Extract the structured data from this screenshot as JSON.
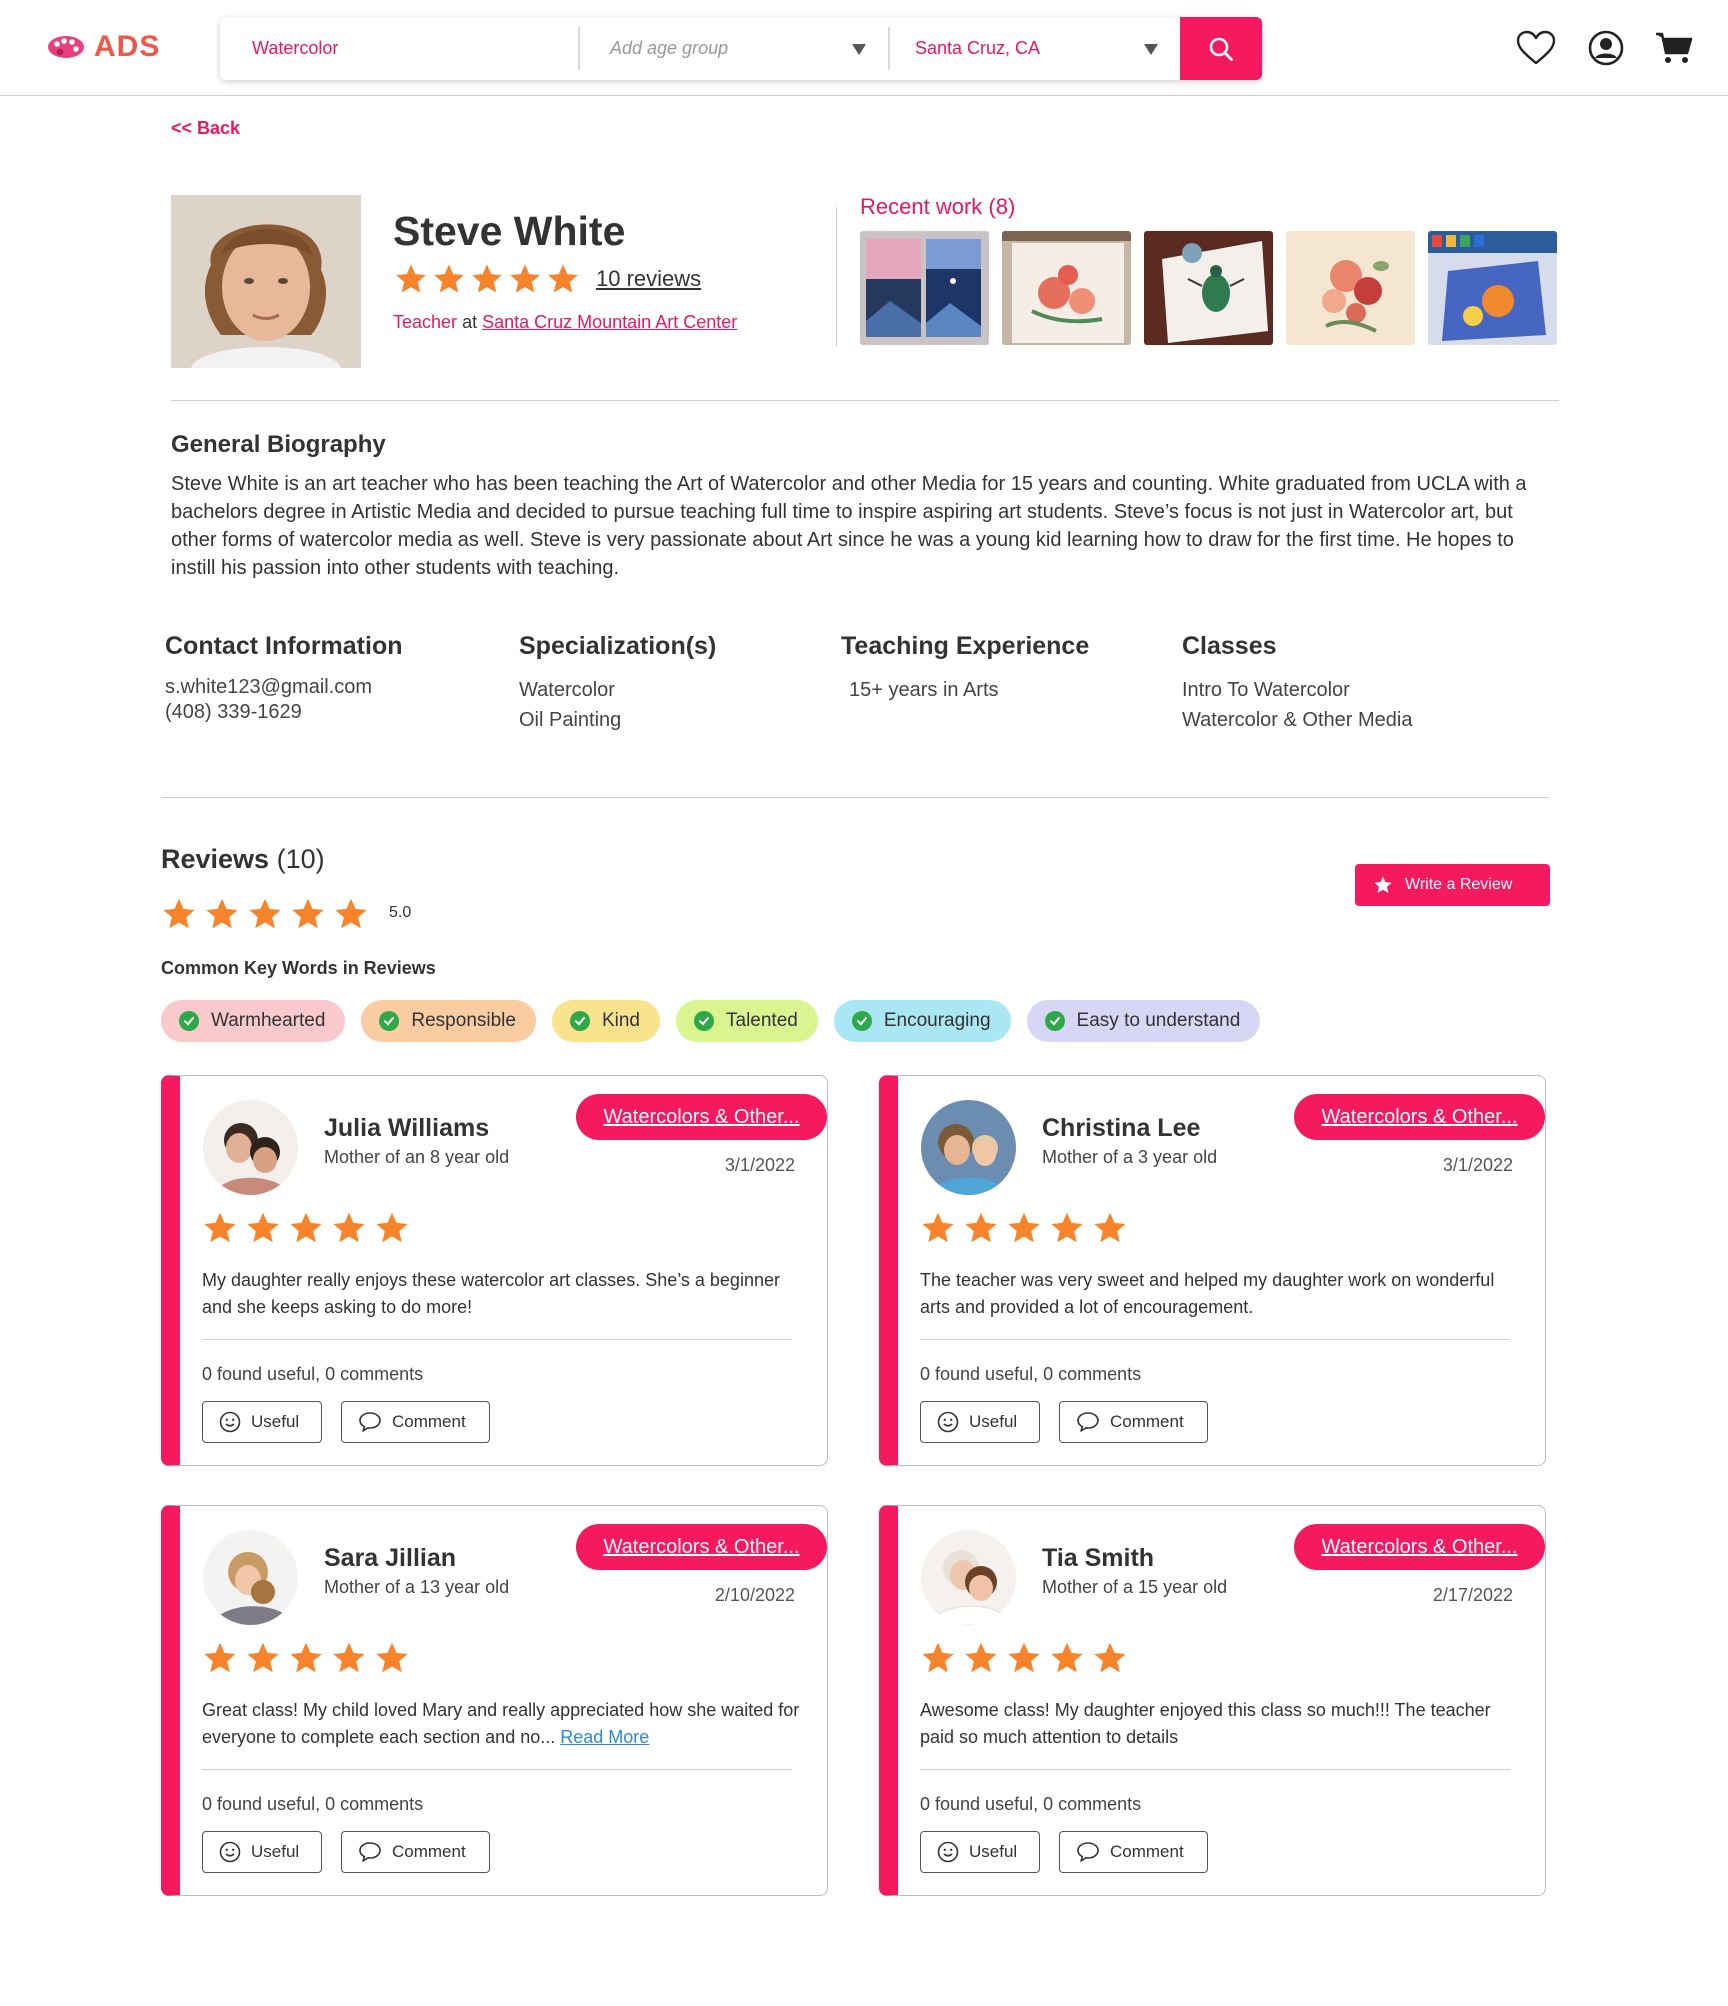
{
  "header": {
    "logo_text": "ADS",
    "search": {
      "query": "Watercolor",
      "age_placeholder": "Add age group",
      "location": "Santa Cruz, CA"
    },
    "icons": [
      "search-icon",
      "heart-icon",
      "user-icon",
      "cart-icon"
    ]
  },
  "back_label": "<< Back",
  "teacher": {
    "name": "Steve White",
    "rating": 5,
    "reviews_link": "10 reviews",
    "role": "Teacher",
    "at": "at",
    "org": "Santa Cruz Mountain Art Center"
  },
  "recent_work": {
    "title": "Recent work (8)"
  },
  "bio": {
    "title": "General Biography",
    "text": "Steve White is an art teacher who has been teaching the Art of Watercolor and other Media for 15 years and counting. White graduated from UCLA with a bachelors degree in Artistic Media and decided to pursue teaching full time to inspire aspiring art students. Steve’s focus is not just in Watercolor art, but other forms of watercolor media as well. Steve is very passionate about Art since he was a young kid learning how to draw for the first time. He hopes to instill his passion into other students with teaching."
  },
  "info": {
    "contact": {
      "title": "Contact Information",
      "email": "s.white123@gmail.com",
      "phone": "(408) 339-1629"
    },
    "specialization": {
      "title": "Specialization(s)",
      "items": [
        "Watercolor",
        "Oil Painting"
      ]
    },
    "experience": {
      "title": "Teaching Experience",
      "text": "15+ years in Arts"
    },
    "classes": {
      "title": "Classes",
      "items": [
        "Intro To Watercolor",
        "Watercolor & Other Media"
      ]
    }
  },
  "reviews": {
    "title": "Reviews",
    "count": "(10)",
    "average": "5.0",
    "write_label": "Write a Review",
    "keywords_title": "Common Key Words in Reviews",
    "keywords": [
      {
        "label": "Warmhearted",
        "color": "#f9c9cc"
      },
      {
        "label": "Responsible",
        "color": "#fbcba1"
      },
      {
        "label": "Kind",
        "color": "#fbe38e"
      },
      {
        "label": "Talented",
        "color": "#d9f58f"
      },
      {
        "label": "Encouraging",
        "color": "#a9e7f4"
      },
      {
        "label": "Easy to understand",
        "color": "#d8d6f5"
      }
    ],
    "items": [
      {
        "name": "Julia Williams",
        "subtitle": "Mother of an 8 year old",
        "tag": "Watercolors & Other...",
        "date": "3/1/2022",
        "rating": 5,
        "text": "My daughter really enjoys these watercolor art classes. She’s a beginner and she keeps asking to do more!",
        "read_more": "",
        "stats": "0 found useful, 0 comments",
        "useful_label": "Useful",
        "comment_label": "Comment"
      },
      {
        "name": "Christina Lee",
        "subtitle": "Mother of a 3 year old",
        "tag": "Watercolors & Other...",
        "date": "3/1/2022",
        "rating": 5,
        "text": "The teacher was very sweet and helped my daughter work on wonderful arts and provided a lot of encouragement.",
        "read_more": "",
        "stats": "0 found useful, 0 comments",
        "useful_label": "Useful",
        "comment_label": "Comment"
      },
      {
        "name": "Sara Jillian",
        "subtitle": "Mother of a 13 year old",
        "tag": "Watercolors & Other...",
        "date": "2/10/2022",
        "rating": 5,
        "text": "Great class! My child loved Mary and really appreciated how she waited for everyone to complete each section and no...",
        "read_more": "Read More",
        "stats": "0 found useful, 0 comments",
        "useful_label": "Useful",
        "comment_label": "Comment"
      },
      {
        "name": "Tia Smith",
        "subtitle": "Mother of a 15 year old",
        "tag": "Watercolors & Other...",
        "date": "2/17/2022",
        "rating": 5,
        "text": "Awesome class! My daughter enjoyed this class so much!!! The teacher paid so much attention to details",
        "read_more": "",
        "stats": "0 found useful, 0 comments",
        "useful_label": "Useful",
        "comment_label": "Comment"
      }
    ]
  },
  "colors": {
    "brand": "#f5195f",
    "star": "#f7832a",
    "check": "#2fa84a",
    "link": "#2b8ad8"
  }
}
